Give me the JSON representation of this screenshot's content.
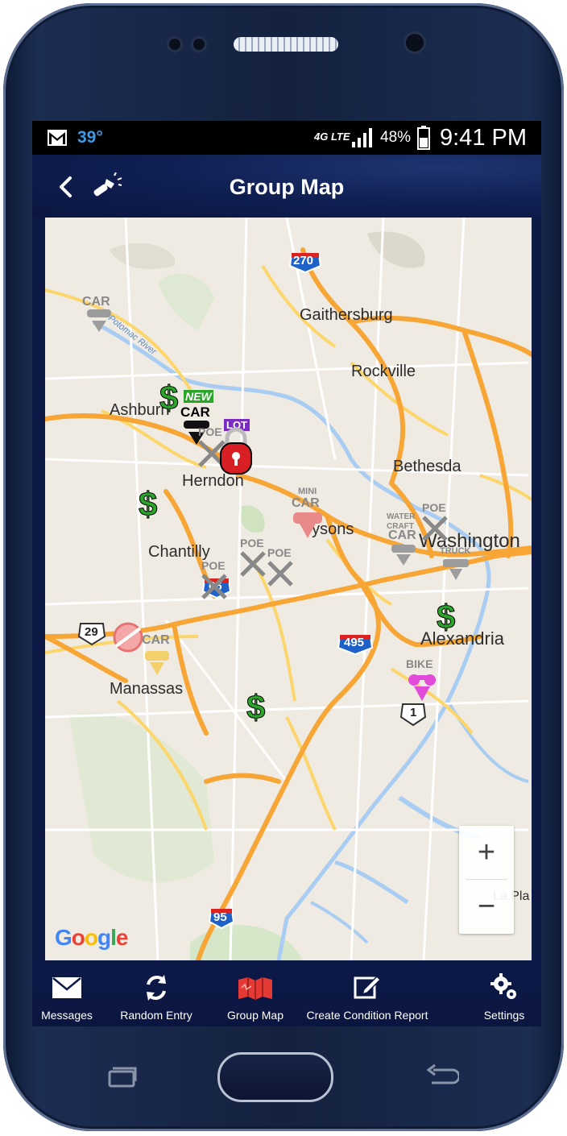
{
  "status_bar": {
    "temperature": "39°",
    "network": "4G LTE",
    "battery": "48%",
    "time": "9:41 PM"
  },
  "header": {
    "title": "Group Map",
    "back_icon": "chevron-left-icon",
    "flashlight_icon": "flashlight-icon"
  },
  "map": {
    "places": [
      {
        "name": "Gaithersburg"
      },
      {
        "name": "Rockville"
      },
      {
        "name": "Ashburn"
      },
      {
        "name": "Herndon"
      },
      {
        "name": "Bethesda"
      },
      {
        "name": "Tysons"
      },
      {
        "name": "Washington"
      },
      {
        "name": "Chantilly"
      },
      {
        "name": "Alexandria"
      },
      {
        "name": "Manassas"
      },
      {
        "name": "La Pla"
      }
    ],
    "road_shields": [
      "270",
      "495",
      "66",
      "29",
      "1",
      "95"
    ],
    "river_label": "Potomac River",
    "markers": {
      "car": "CAR",
      "new": "NEW",
      "lot": "LOT",
      "mini": "MINI",
      "poe": "POE",
      "water": "WATER",
      "craft": "CRAFT",
      "truck": "TRUCK",
      "bike": "BIKE",
      "dollar": "$"
    },
    "zoom_in": "+",
    "zoom_out": "−",
    "attribution": "Google"
  },
  "bottom_nav": {
    "items": [
      {
        "label": "Messages",
        "icon": "envelope-icon"
      },
      {
        "label": "Random Entry",
        "icon": "refresh-icon"
      },
      {
        "label": "Group Map",
        "icon": "map-icon",
        "active": true
      },
      {
        "label": "Create Condition Report",
        "icon": "edit-icon"
      },
      {
        "label": "Settings",
        "icon": "gear-icon"
      }
    ]
  },
  "colors": {
    "accent_active": "#e53935",
    "app_bar": "#0f1f52",
    "highway": "#f7a534"
  }
}
